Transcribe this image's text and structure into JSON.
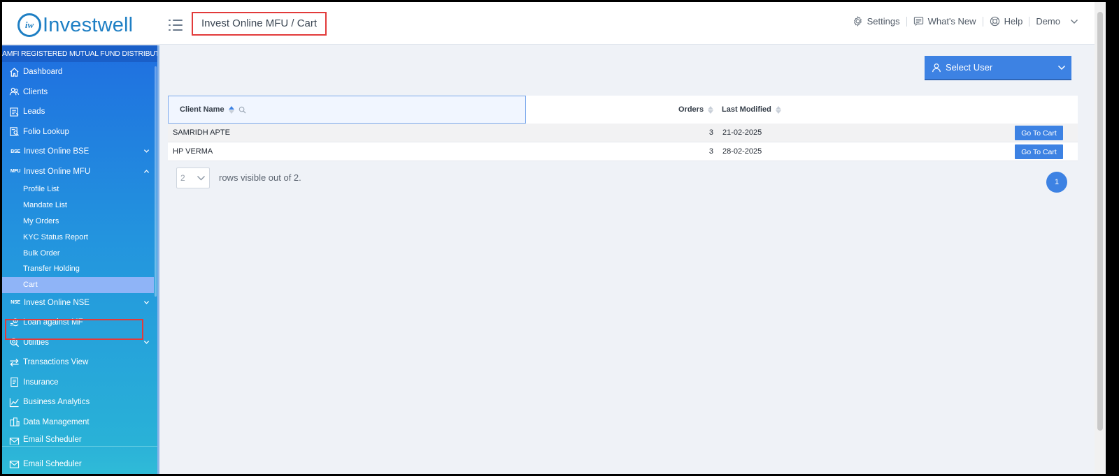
{
  "header": {
    "logo_mark": "iw",
    "logo_text": "Investwell",
    "breadcrumb": "Invest Online MFU / Cart",
    "settings": "Settings",
    "whats_new": "What's New",
    "help": "Help",
    "user": "Demo"
  },
  "sidebar": {
    "banner": "AMFI REGISTERED MUTUAL FUND DISTRIBUTOR",
    "items": [
      {
        "label": "Dashboard",
        "icon": "home-icon"
      },
      {
        "label": "Clients",
        "icon": "users-icon"
      },
      {
        "label": "Leads",
        "icon": "leads-icon"
      },
      {
        "label": "Folio Lookup",
        "icon": "folio-icon"
      },
      {
        "label": "Invest Online BSE",
        "icon_text": "BSE"
      },
      {
        "label": "Invest Online MFU",
        "icon_text": "MFU"
      }
    ],
    "mfu_sub": [
      "Profile List",
      "Mandate List",
      "My Orders",
      "KYC Status Report",
      "Bulk Order",
      "Transfer Holding",
      "Cart"
    ],
    "items2": [
      {
        "label": "Invest Online NSE",
        "icon_text": "NSE"
      },
      {
        "label": "Loan against MF",
        "icon": "loan-icon"
      },
      {
        "label": "Utilities",
        "icon": "utilities-icon"
      },
      {
        "label": "Transactions View",
        "icon": "transfer-icon"
      },
      {
        "label": "Insurance",
        "icon": "insurance-icon"
      },
      {
        "label": "Business Analytics",
        "icon": "analytics-icon"
      },
      {
        "label": "Data Management",
        "icon": "database-icon"
      },
      {
        "label": "Email Scheduler",
        "icon": "mail-icon"
      }
    ],
    "bottom": {
      "label": "Email Scheduler",
      "icon": "mail-icon"
    }
  },
  "main": {
    "select_user": "Select User",
    "table": {
      "columns": [
        "Client Name",
        "Orders",
        "Last Modified"
      ],
      "rows": [
        {
          "name": "SAMRIDH APTE",
          "orders": "3",
          "modified": "21-02-2025",
          "action": "Go To Cart"
        },
        {
          "name": "HP VERMA",
          "orders": "3",
          "modified": "28-02-2025",
          "action": "Go To Cart"
        }
      ]
    },
    "rows_per_page": "2",
    "rows_text": "rows visible out of 2.",
    "page": "1"
  },
  "colors": {
    "accent": "#3d82e3",
    "sidebar_top": "#1f6fe0",
    "sidebar_bottom": "#2ab6d6",
    "highlight_box": "#e23a3a"
  }
}
